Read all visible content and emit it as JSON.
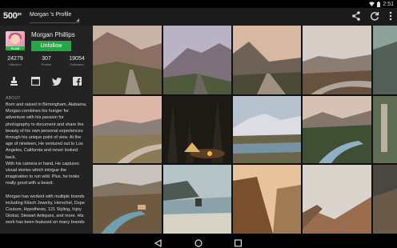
{
  "status_bar": {
    "time": "2:51",
    "icons": [
      "wifi-icon",
      "battery-icon"
    ]
  },
  "app_bar": {
    "logo": "500",
    "logo_sup": "px",
    "profile_selector": "Morgan 's Profile",
    "actions": [
      "share-icon",
      "refresh-icon",
      "overflow-menu-icon"
    ]
  },
  "profile": {
    "name": "Morgan Phillips",
    "badge": "PLUS",
    "unfollow_label": "Unfollow",
    "stats": [
      {
        "value": "24279",
        "label": "Affection"
      },
      {
        "value": "307",
        "label": "Photos"
      },
      {
        "value": "19054",
        "label": "Followers"
      }
    ],
    "social_icons": [
      "stamp-icon",
      "website-icon",
      "twitter-icon",
      "facebook-icon"
    ],
    "about_heading": "ABOUT",
    "bio_lines_1": [
      "Born and raised in Birmingham, Alabama,",
      "Morgan combines his hunger for",
      "adventure with his passion for",
      "photography to document and share the",
      "beauty of his own personal experiences",
      "through his unique point of view. At the",
      "age of nineteen, He ventured out to Los",
      "Angeles, California and never looked back.",
      "With his camera in hand, He captures",
      "visual stories which intrigue the",
      "imagination to run wild. Plus, he looks",
      "really good with a beard."
    ],
    "bio_lines_2": [
      "Morgan has worked with multiple brands",
      "including Kitsch Jewelry, Herschel, Dope",
      "Couture, Hypothesis, 121 Styling, Injoy",
      "Global, Stewart Antiques, and more. His",
      "work has been featured on many brands"
    ]
  },
  "photo_grid": {
    "columns": 5,
    "rows": 3,
    "photos": [
      "mountain road at dusk",
      "mountain pass highway",
      "road through hills",
      "curving road in desert",
      "partial mountain",
      "road through prairie at sunset",
      "night tent in forest",
      "snowy mountain lake",
      "river in mountain valley",
      "partial rocks",
      "valley river with cabins",
      "misty beach rocks",
      "sunlit canyon wall",
      "misty desert gorge",
      "partial landscape"
    ]
  },
  "nav_bar": {
    "buttons": [
      "back-icon",
      "home-icon",
      "recents-icon"
    ]
  },
  "colors": {
    "accent_green": "#25a745",
    "sidebar_bg": "#232323",
    "appbar_bg": "#1b1b1b"
  }
}
